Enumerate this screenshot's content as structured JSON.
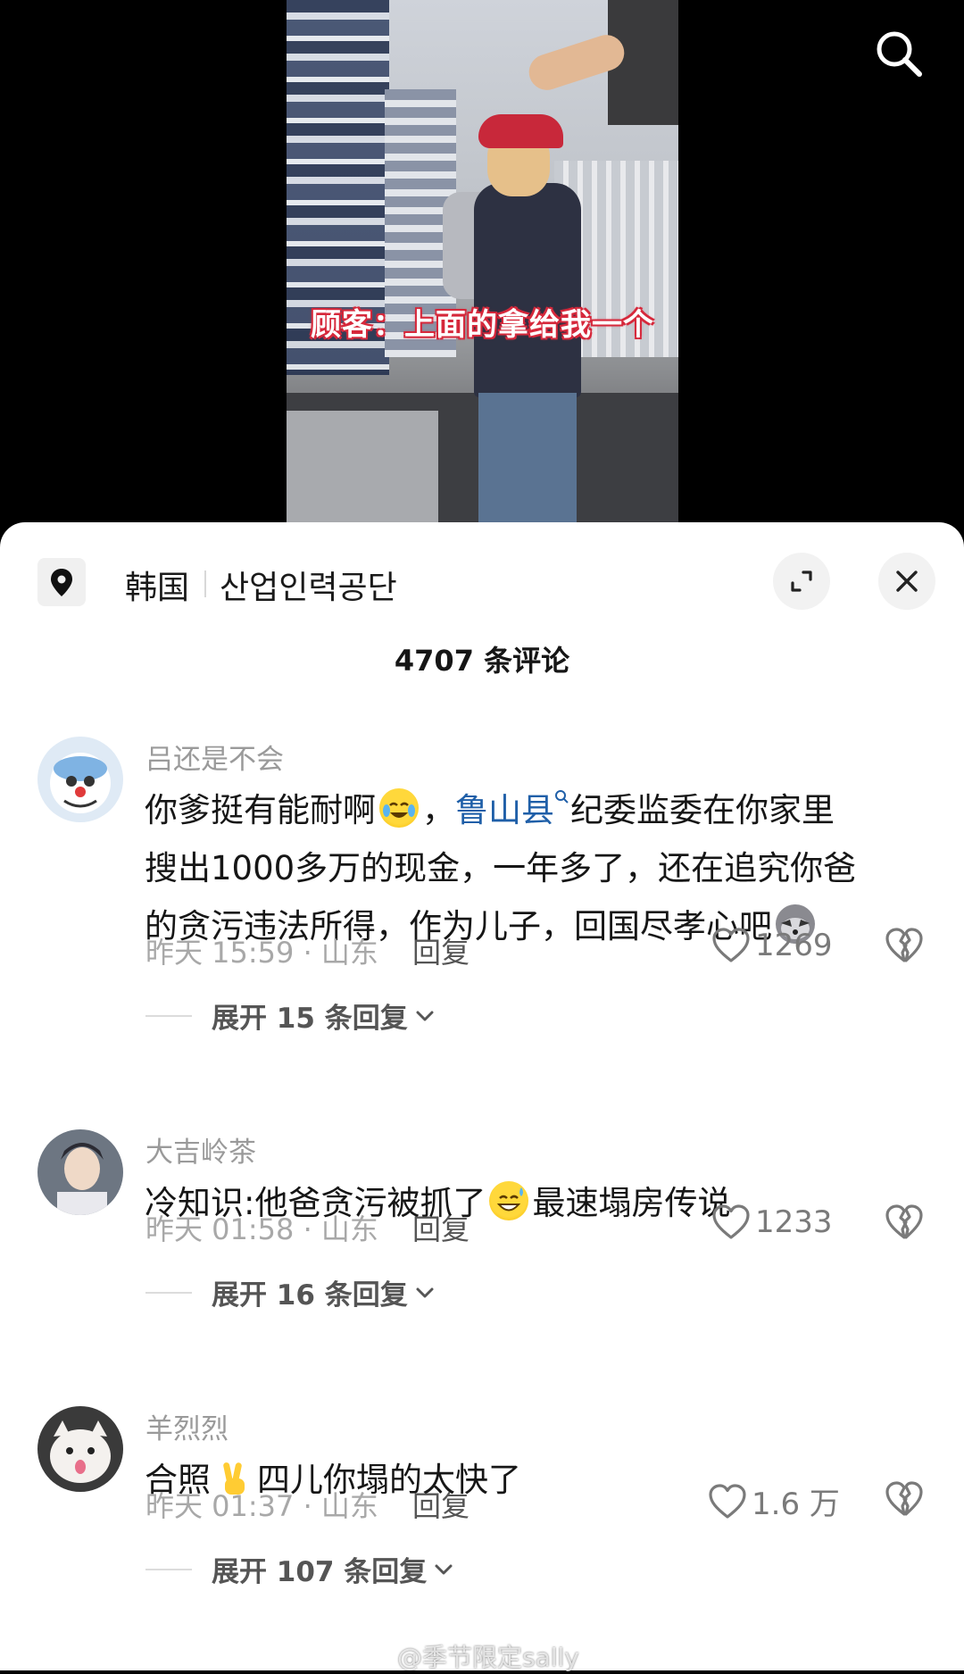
{
  "video": {
    "subtitle": "顾客：上面的拿给我一个"
  },
  "location": {
    "country": "韩国",
    "place": "산업인력공단"
  },
  "comments_header": {
    "count_label": "4707 条评论"
  },
  "comments": [
    {
      "username": "吕还是不会",
      "text_before_link": "你爹挺有能耐啊",
      "link_text": "鲁山县",
      "line1_after_link": "纪委监委在你家里",
      "line2": "搜出1000多万的现金，一年多了，还在追究你爸",
      "line3": "的贪污违法所得，作为儿子，回国尽孝心吧",
      "comma": "，",
      "time_location": "昨天 15:59 · 山东",
      "reply_label": "回复",
      "likes": "1269",
      "expand_label": "展开 15 条回复"
    },
    {
      "username": "大吉岭茶",
      "text_part1": "冷知识:他爸贪污被抓了",
      "text_part2": "最速塌房传说",
      "time_location": "昨天 01:58 · 山东",
      "reply_label": "回复",
      "likes": "1233",
      "expand_label": "展开 16 条回复"
    },
    {
      "username": "羊烈烈",
      "text_part1": "合照",
      "text_part2": "四儿你塌的太快了",
      "time_location": "昨天 01:37 · 山东",
      "reply_label": "回复",
      "likes": "1.6 万",
      "expand_label": "展开 107 条回复"
    }
  ],
  "watermark": "@季节限定sally",
  "colors": {
    "link": "#1f5fa8",
    "subtitle_outline": "#d6283b"
  }
}
